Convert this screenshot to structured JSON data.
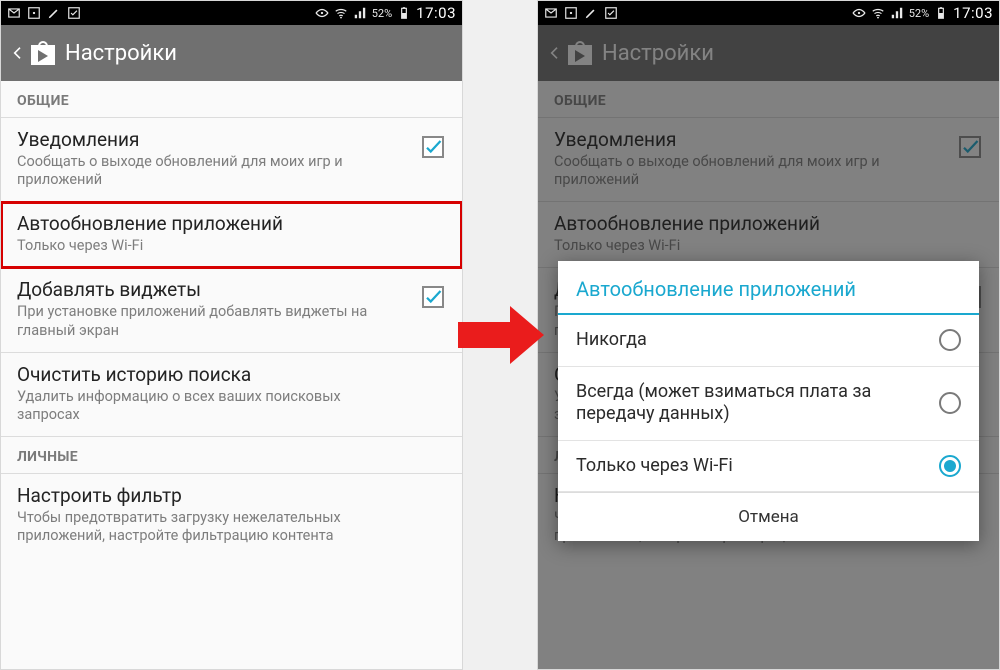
{
  "statusbar": {
    "battery": "52%",
    "time": "17:03"
  },
  "actionbar": {
    "title": "Настройки"
  },
  "sections": {
    "general": "ОБЩИЕ",
    "personal": "ЛИЧНЫЕ"
  },
  "settings": {
    "notifications": {
      "title": "Уведомления",
      "sub": "Сообщать о выходе обновлений для моих игр и приложений"
    },
    "autoupdate": {
      "title": "Автообновление приложений",
      "sub": "Только через Wi-Fi"
    },
    "widgets": {
      "title": "Добавлять виджеты",
      "sub": "При установке приложений добавлять виджеты на главный экран"
    },
    "clearhistory": {
      "title": "Очистить историю поиска",
      "sub": "Удалить информацию о всех ваших поисковых запросах"
    },
    "filter": {
      "title": "Настроить фильтр",
      "sub": "Чтобы предотвратить загрузку нежелательных приложений, настройте фильтрацию контента"
    }
  },
  "dialog": {
    "title": "Автообновление приложений",
    "options": {
      "never": "Никогда",
      "always": "Всегда (может взиматься плата за передачу данных)",
      "wifi": "Только через Wi-Fi"
    },
    "cancel": "Отмена"
  }
}
